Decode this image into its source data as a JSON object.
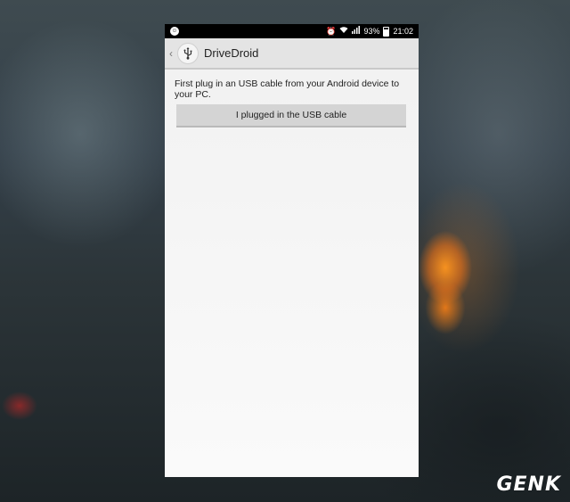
{
  "status_bar": {
    "notification_icon": "android-icon",
    "icons": [
      "alarm-icon",
      "wifi-icon",
      "signal-icon"
    ],
    "battery_percent": "93%",
    "time": "21:02"
  },
  "action_bar": {
    "back_icon": "chevron-left-icon",
    "app_icon": "usb-icon",
    "title": "DriveDroid"
  },
  "content": {
    "instruction": "First plug in an USB cable from your Android device to your PC.",
    "button_label": "I plugged in the USB cable"
  },
  "watermark": {
    "text": "GENK"
  }
}
